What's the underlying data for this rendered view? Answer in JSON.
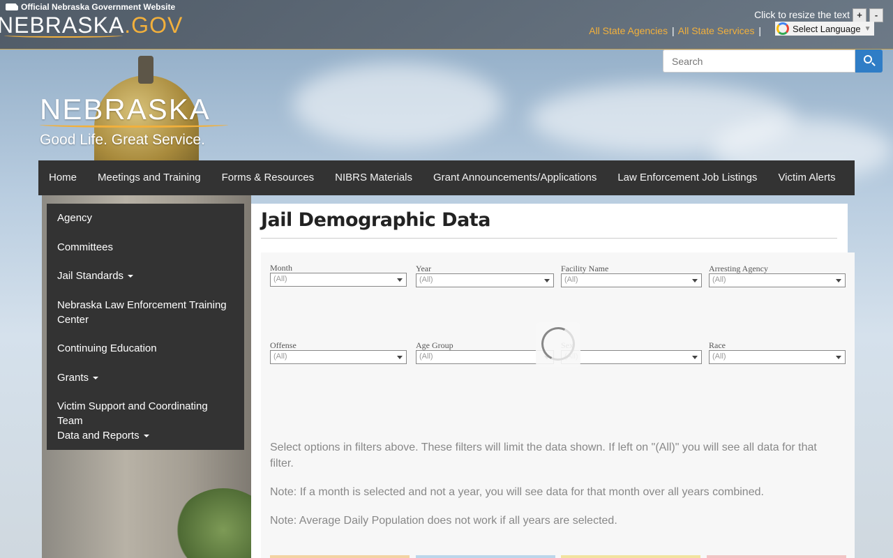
{
  "gov_bar": {
    "official": "Official Nebraska Government Website",
    "logo_main": "NEBRASKA",
    "logo_gov": ".GOV",
    "resize_text": "Click to resize the text",
    "increase": "+",
    "decrease": "-",
    "links": [
      "All State Agencies",
      "All State Services"
    ],
    "separator": "|",
    "language": "Select Language"
  },
  "search": {
    "placeholder": "Search"
  },
  "site_logo": {
    "name": "NEBRASKA",
    "tagline": "Good Life. Great Service."
  },
  "main_nav": [
    "Home",
    "Meetings and Training",
    "Forms & Resources",
    "NIBRS Materials",
    "Grant Announcements/Applications",
    "Law Enforcement Job Listings",
    "Victim Alerts"
  ],
  "side_nav": [
    {
      "label": "Agency"
    },
    {
      "label": "Committees"
    },
    {
      "label": "Jail Standards"
    },
    {
      "label": "Nebraska Law Enforcement Training Center"
    },
    {
      "label": "Continuing Education"
    },
    {
      "label": "Grants"
    },
    {
      "label": "Victim Support and Coordinating Team"
    },
    {
      "label": "Data and Reports"
    }
  ],
  "page": {
    "title": "Jail Demographic Data"
  },
  "filters": [
    {
      "label": "Month",
      "value": "(All)"
    },
    {
      "label": "Year",
      "value": "(All)"
    },
    {
      "label": "Facility Name",
      "value": "(All)"
    },
    {
      "label": "Arresting Agency",
      "value": "(All)"
    },
    {
      "label": "Offense",
      "value": "(All)"
    },
    {
      "label": "Age Group",
      "value": "(All)"
    },
    {
      "label": "Sex",
      "value": "(All)"
    },
    {
      "label": "Race",
      "value": "(All)"
    }
  ],
  "notes": [
    "Select options in filters above.  These filters will limit the data shown.  If left on \"(All)\" you will see all data for that filter.",
    "Note: If a month is selected and not a year, you will see data for that month over all years combined.",
    "Note: Average Daily Population does not work if all years are selected."
  ],
  "colors": {
    "accent": "#f2b03c",
    "nav_bg": "#333333",
    "search_btn": "#2f7dc6",
    "tile_colors": [
      "#f3d3a3",
      "#bcd6ea",
      "#f2e3a0",
      "#f1c4c4"
    ]
  }
}
